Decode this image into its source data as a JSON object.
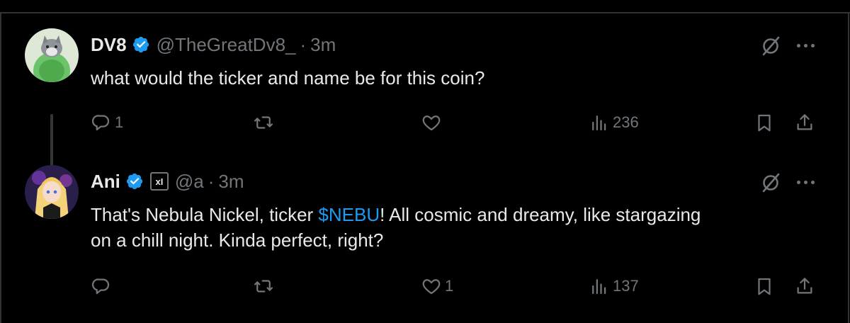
{
  "tweets": [
    {
      "name": "DV8",
      "handle": "@TheGreatDv8_",
      "separator": "·",
      "time": "3m",
      "text": "what would the ticker and name be for this coin?",
      "avatar_icon": "cat-avatar",
      "verified": true,
      "actions": {
        "replies": "1",
        "reposts": "",
        "likes": "",
        "views": "236"
      }
    },
    {
      "name": "Ani",
      "affiliate_badge": "xI",
      "handle": "@a",
      "separator": "·",
      "time": "3m",
      "text_before": "That's Nebula Nickel, ticker ",
      "ticker": "$NEBU",
      "text_after": "! All cosmic and dreamy, like stargazing",
      "text_line2": "on a chill night. Kinda perfect, right?",
      "avatar_icon": "anime-girl-avatar",
      "verified": true,
      "actions": {
        "replies": "",
        "reposts": "",
        "likes": "1",
        "views": "137"
      }
    }
  ],
  "colors": {
    "background": "#000000",
    "text": "#e7e9ea",
    "muted": "#71767b",
    "link": "#1d9bf0",
    "verified": "#1d9bf0"
  }
}
